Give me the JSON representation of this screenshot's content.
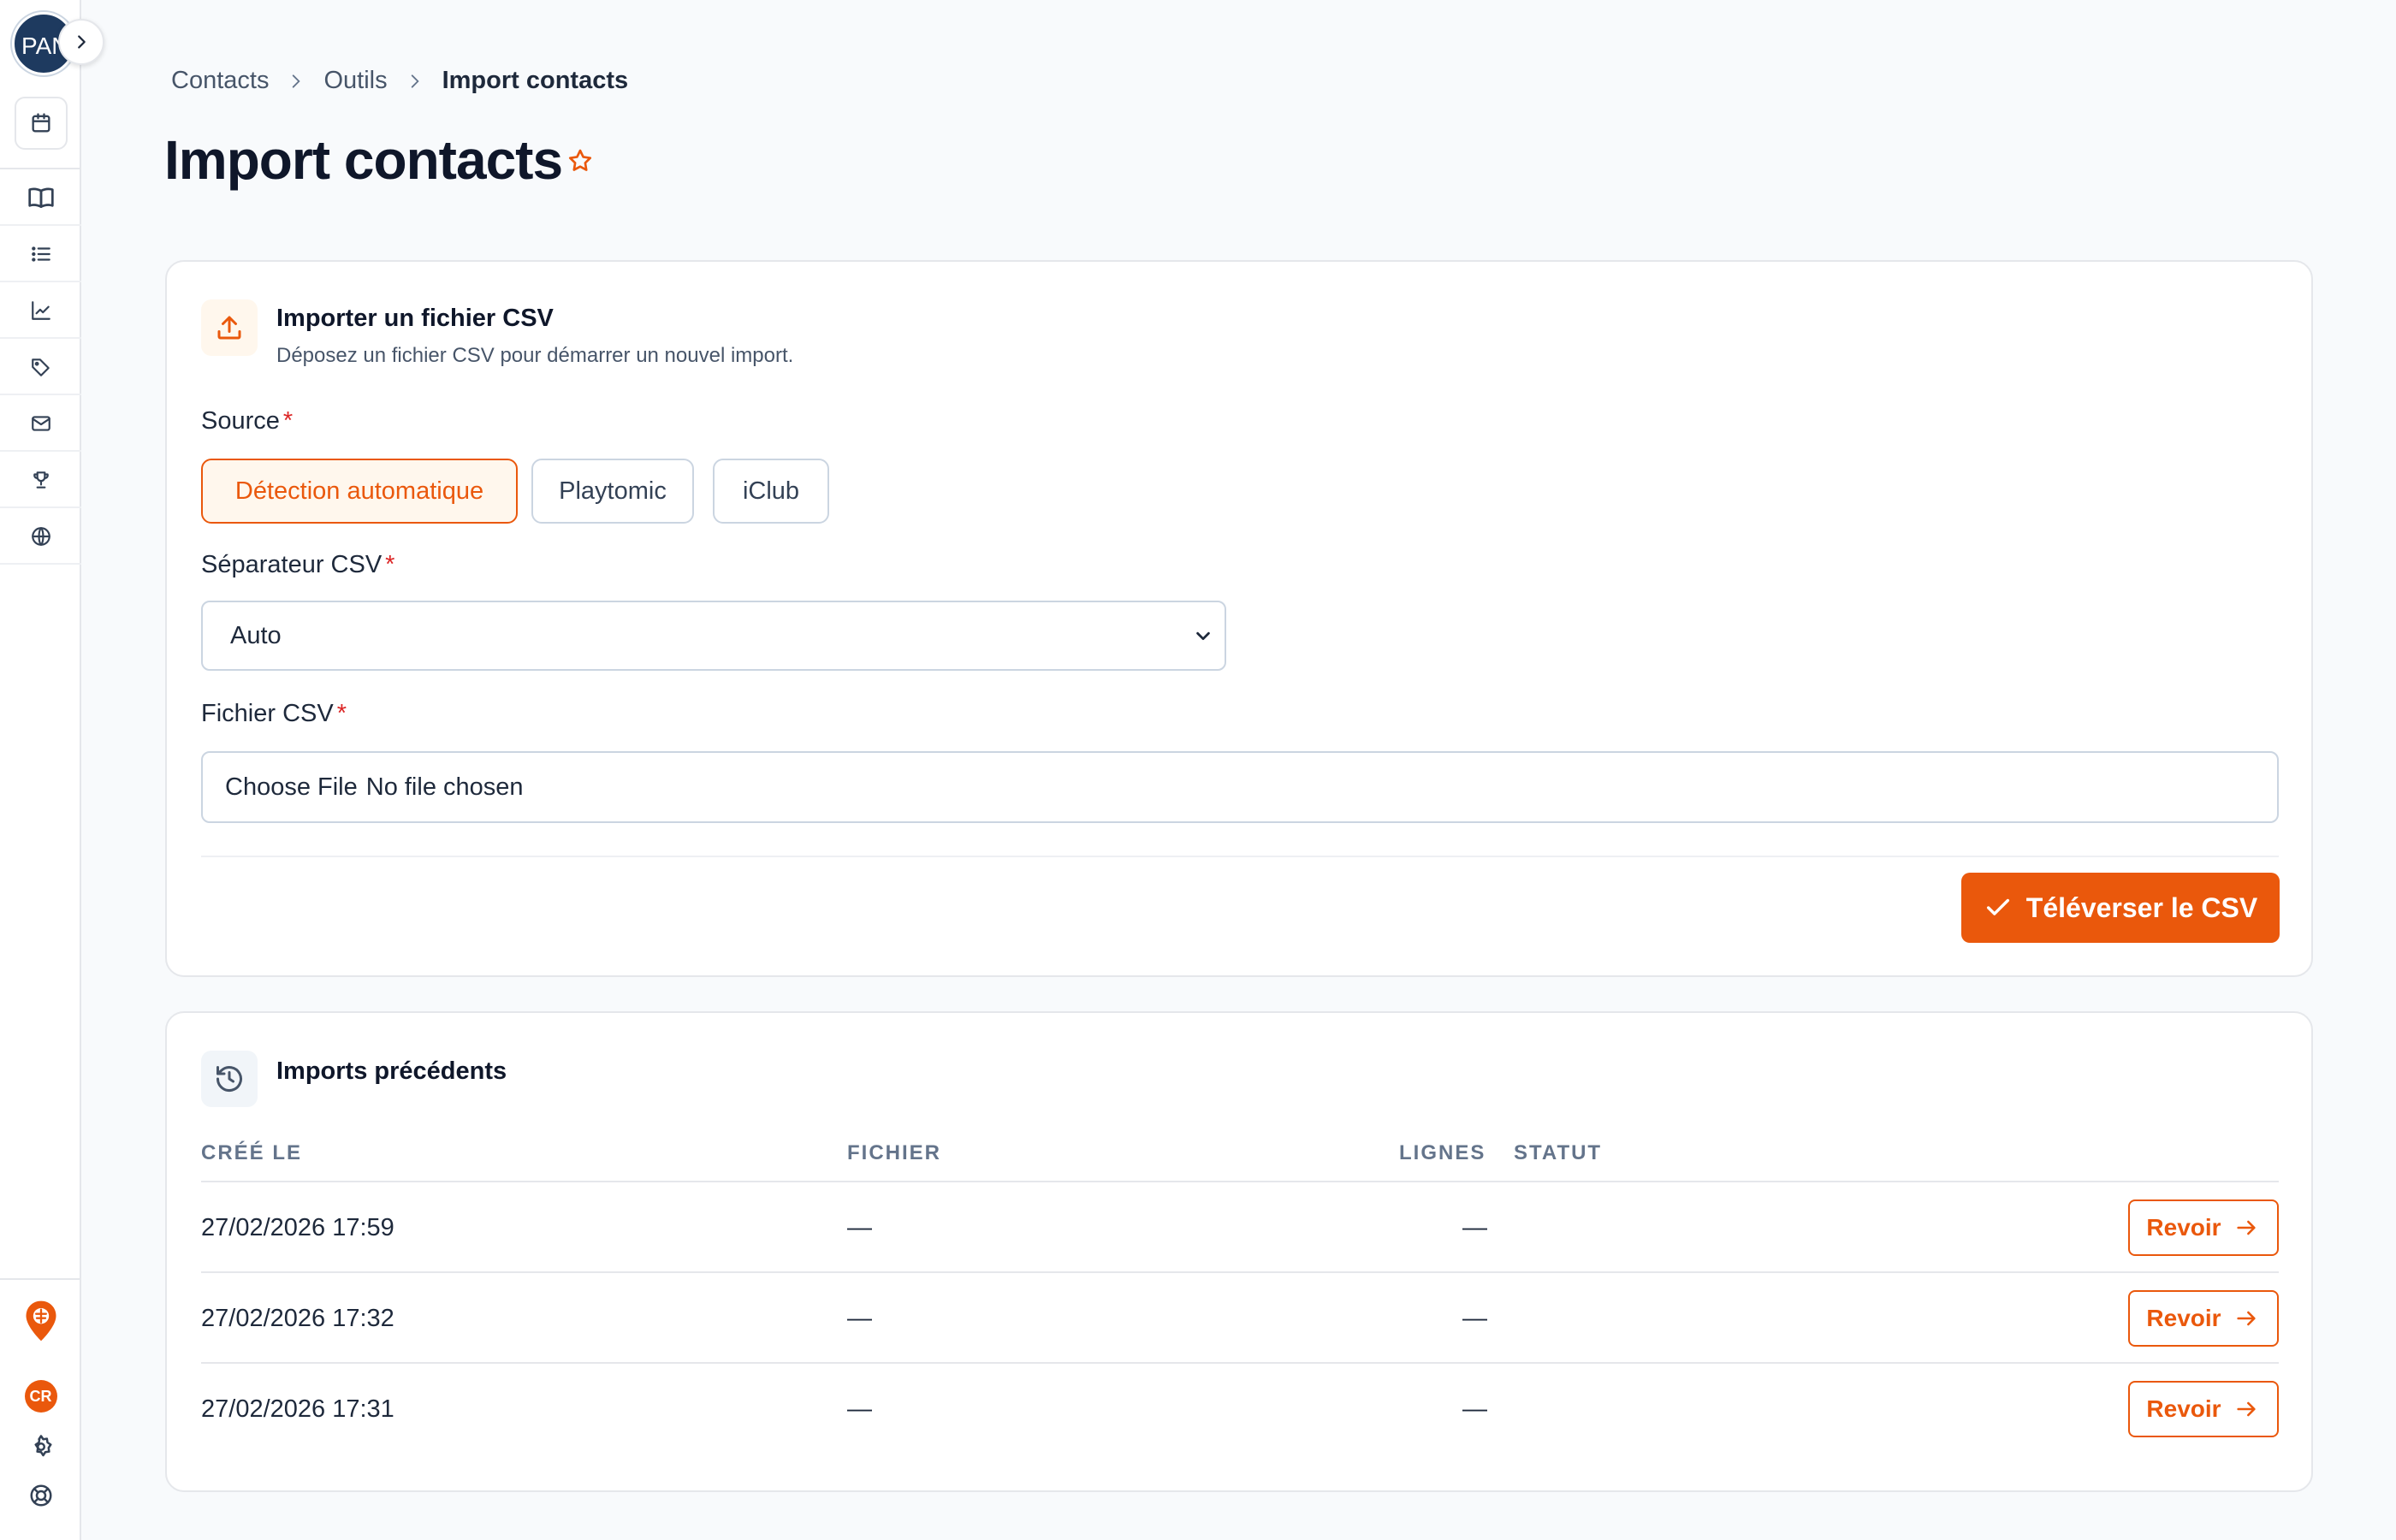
{
  "sidebar": {
    "avatar_initials": "PAN",
    "user_badge": "CR",
    "nav_icons": [
      "calendar-icon",
      "book-icon",
      "list-icon",
      "chart-icon",
      "tag-icon",
      "mail-icon",
      "trophy-icon",
      "globe-icon"
    ]
  },
  "breadcrumb": {
    "items": [
      "Contacts",
      "Outils",
      "Import contacts"
    ]
  },
  "page": {
    "title": "Import contacts"
  },
  "upload": {
    "title": "Importer un fichier CSV",
    "subtitle": "Déposez un fichier CSV pour démarrer un nouvel import.",
    "source_label": "Source",
    "required_mark": "*",
    "sources": [
      "Détection automatique",
      "Playtomic",
      "iClub"
    ],
    "source_selected": "Détection automatique",
    "separator_label": "Séparateur CSV",
    "separator_value": "Auto",
    "file_label": "Fichier CSV",
    "file_button": "Choose File",
    "file_status": "No file chosen",
    "submit_label": "Téléverser le CSV"
  },
  "history": {
    "title": "Imports précédents",
    "columns": [
      "CRÉÉ LE",
      "FICHIER",
      "LIGNES",
      "STATUT"
    ],
    "rows": [
      {
        "created": "27/02/2026 17:59",
        "file": "—",
        "lines": "—",
        "status": "",
        "action": "Revoir"
      },
      {
        "created": "27/02/2026 17:32",
        "file": "—",
        "lines": "—",
        "status": "",
        "action": "Revoir"
      },
      {
        "created": "27/02/2026 17:31",
        "file": "—",
        "lines": "—",
        "status": "",
        "action": "Revoir"
      }
    ]
  },
  "colors": {
    "accent": "#ea580c",
    "required": "#dc2626",
    "background": "#f8fafc"
  }
}
